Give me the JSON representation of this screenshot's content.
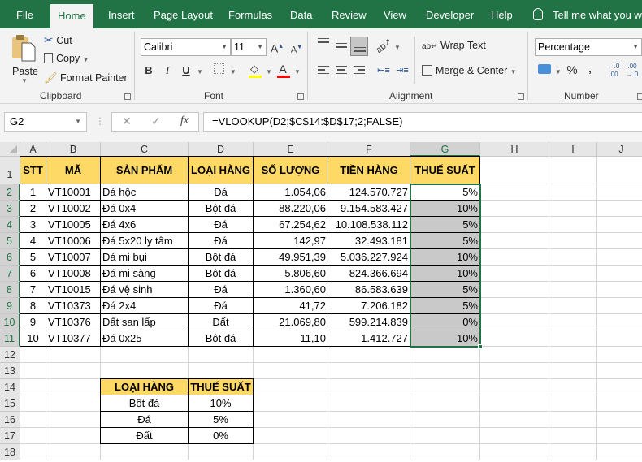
{
  "tabs": [
    {
      "label": "File",
      "active": false
    },
    {
      "label": "Home",
      "active": true
    },
    {
      "label": "Insert",
      "active": false
    },
    {
      "label": "Page Layout",
      "active": false
    },
    {
      "label": "Formulas",
      "active": false
    },
    {
      "label": "Data",
      "active": false
    },
    {
      "label": "Review",
      "active": false
    },
    {
      "label": "View",
      "active": false
    },
    {
      "label": "Developer",
      "active": false
    },
    {
      "label": "Help",
      "active": false
    }
  ],
  "tell_me": "Tell me what you want to do",
  "ribbon": {
    "clipboard": {
      "paste": "Paste",
      "cut": "Cut",
      "copy": "Copy",
      "format_painter": "Format Painter",
      "label": "Clipboard"
    },
    "font": {
      "font_name": "Calibri",
      "font_size": "11",
      "bold": "B",
      "italic": "I",
      "underline": "U",
      "grow": "A",
      "shrink": "A",
      "font_color": "A",
      "label": "Font",
      "fill_color": "#ffff00",
      "text_color": "#ff0000"
    },
    "alignment": {
      "wrap_text": "Wrap Text",
      "merge_center": "Merge & Center",
      "label": "Alignment"
    },
    "number": {
      "format": "Percentage",
      "percent": "%",
      "comma": ",",
      "inc_decimal": "←.0 .00",
      "dec_decimal": ".00 →.0",
      "label": "Number"
    }
  },
  "formula_bar": {
    "name_box": "G2",
    "cancel": "✕",
    "enter": "✓",
    "fx": "fx",
    "formula": "=VLOOKUP(D2;$C$14:$D$17;2;FALSE)"
  },
  "sheet": {
    "columns": [
      "A",
      "B",
      "C",
      "D",
      "E",
      "F",
      "G",
      "H",
      "I",
      "J"
    ],
    "selected_column": "G",
    "rows": [
      "1",
      "2",
      "3",
      "4",
      "5",
      "6",
      "7",
      "8",
      "9",
      "10",
      "11",
      "12",
      "13",
      "14",
      "15",
      "16",
      "17",
      "18"
    ],
    "main_table": {
      "headers": [
        "STT",
        "MÃ",
        "SẢN PHẨM",
        "LOẠI HÀNG",
        "SỐ LƯỢNG",
        "TIỀN HÀNG",
        "THUẾ SUẤT"
      ],
      "rows": [
        [
          "1",
          "VT10001",
          "Đá hộc",
          "Đá",
          "1.054,06",
          "124.570.727",
          "5%"
        ],
        [
          "2",
          "VT10002",
          "Đá 0x4",
          "Bột đá",
          "88.220,06",
          "9.154.583.427",
          "10%"
        ],
        [
          "3",
          "VT10005",
          "Đá 4x6",
          "Đá",
          "67.254,62",
          "10.108.538.112",
          "5%"
        ],
        [
          "4",
          "VT10006",
          "Đá 5x20 ly tâm",
          "Đá",
          "142,97",
          "32.493.181",
          "5%"
        ],
        [
          "5",
          "VT10007",
          "Đá mi bụi",
          "Bột đá",
          "49.951,39",
          "5.036.227.924",
          "10%"
        ],
        [
          "6",
          "VT10008",
          "Đá mi sàng",
          "Bột đá",
          "5.806,60",
          "824.366.694",
          "10%"
        ],
        [
          "7",
          "VT10015",
          "Đá vệ sinh",
          "Đá",
          "1.360,60",
          "86.583.639",
          "5%"
        ],
        [
          "8",
          "VT10373",
          "Đá 2x4",
          "Đá",
          "41,72",
          "7.206.182",
          "5%"
        ],
        [
          "9",
          "VT10376",
          "Đất san lấp",
          "Đất",
          "21.069,80",
          "599.214.839",
          "0%"
        ],
        [
          "10",
          "VT10377",
          "Đá 0x25",
          "Bột đá",
          "11,10",
          "1.412.727",
          "10%"
        ]
      ]
    },
    "lookup_table": {
      "headers": [
        "LOẠI HÀNG",
        "THUẾ SUẤT"
      ],
      "rows": [
        [
          "Bột đá",
          "10%"
        ],
        [
          "Đá",
          "5%"
        ],
        [
          "Đất",
          "0%"
        ]
      ]
    },
    "colors": {
      "header_fill": "#ffd966",
      "selection": "#217346",
      "selected_fill": "#c9c9c9"
    }
  }
}
